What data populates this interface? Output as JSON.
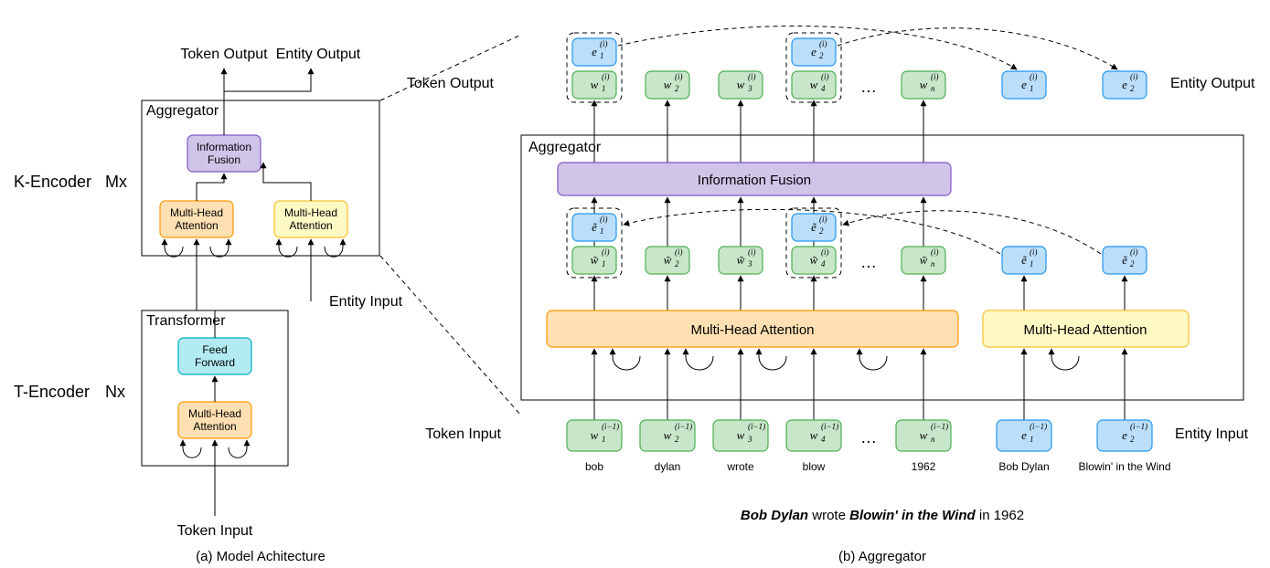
{
  "left": {
    "k_encoder_label": "K-Encoder",
    "k_mx": "Mx",
    "t_encoder_label": "T-Encoder",
    "t_nx": "Nx",
    "aggregator_label": "Aggregator",
    "transformer_label": "Transformer",
    "info_fusion": "Information\nFusion",
    "mha": "Multi-Head\nAttention",
    "feed_forward": "Feed\nForward",
    "token_output": "Token Output",
    "entity_output": "Entity Output",
    "entity_input": "Entity Input",
    "token_input": "Token Input",
    "caption": "(a) Model Achitecture"
  },
  "right": {
    "token_output": "Token Output",
    "entity_output": "Entity Output",
    "aggregator_label": "Aggregator",
    "info_fusion": "Information Fusion",
    "mha_tokens": "Multi-Head Attention",
    "mha_entities": "Multi-Head Attention",
    "token_input": "Token Input",
    "entity_input": "Entity Input",
    "token_words": [
      "bob",
      "dylan",
      "wrote",
      "blow",
      "1962"
    ],
    "entity_words": [
      "Bob Dylan",
      "Blowin' in the Wind"
    ],
    "dots": "…",
    "sentence_plain_1": " wrote ",
    "sentence_plain_2": " in 1962",
    "sentence_bold_1": "Bob Dylan",
    "sentence_bold_2": "Blowin' in the Wind",
    "caption": "(b) Aggregator",
    "tok_out": [
      "w_1^(i)",
      "w_2^(i)",
      "w_3^(i)",
      "w_4^(i)",
      "w_n^(i)"
    ],
    "ent_out": [
      "e_1^(i)",
      "e_2^(i)"
    ],
    "tok_mid": [
      "w~_1^(i)",
      "w~_2^(i)",
      "w~_3^(i)",
      "w~_4^(i)",
      "w~_n^(i)"
    ],
    "ent_mid": [
      "e~_1^(i)",
      "e~_2^(i)"
    ],
    "tok_in": [
      "w_1^(i-1)",
      "w_2^(i-1)",
      "w_3^(i-1)",
      "w_4^(i-1)",
      "w_n^(i-1)"
    ],
    "ent_in": [
      "e_1^(i-1)",
      "e_2^(i-1)"
    ]
  }
}
